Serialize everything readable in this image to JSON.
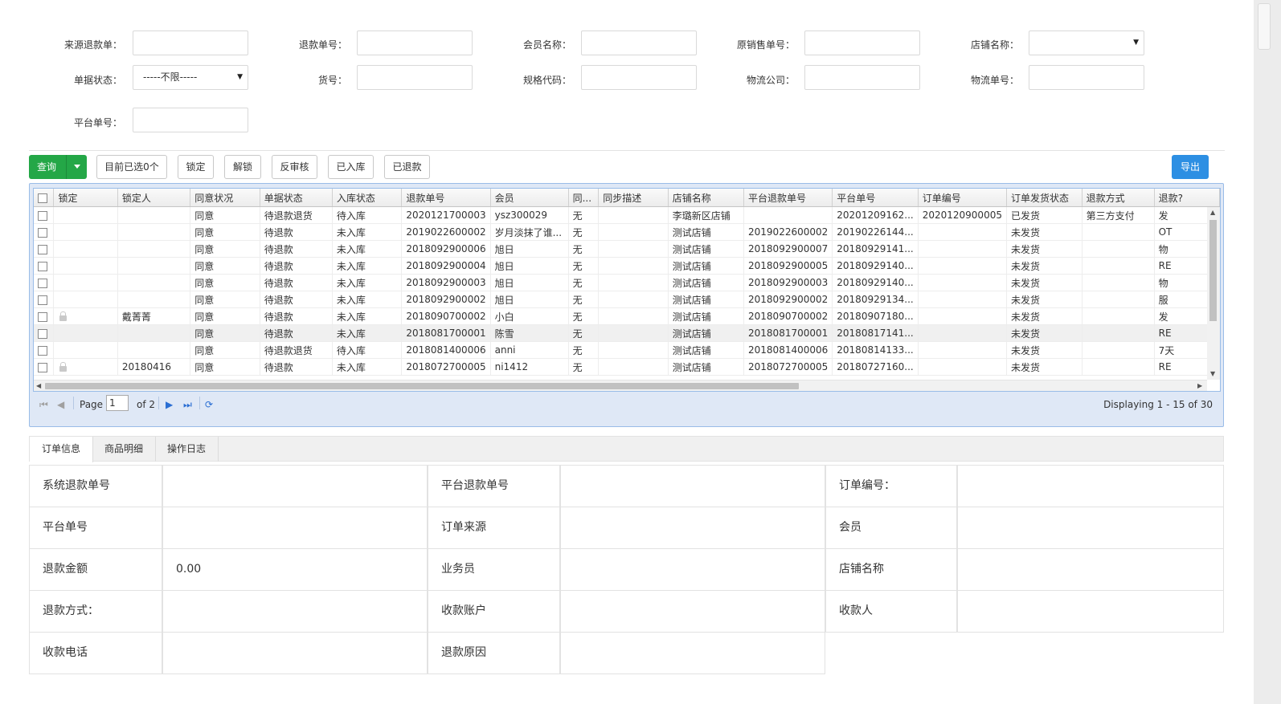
{
  "filters": {
    "labels": [
      "来源退款单：",
      "退款单号：",
      "会员名称：",
      "原销售单号：",
      "店铺名称：",
      "单据状态：",
      "货号：",
      "规格代码：",
      "物流公司：",
      "物流单号：",
      "平台单号："
    ],
    "status_value": "-----不限-----"
  },
  "toolbar": {
    "query": "查询",
    "selected": "目前已选0个",
    "lock": "锁定",
    "unlock": "解锁",
    "unaudit": "反审核",
    "instock": "已入库",
    "refunded": "已退款",
    "export": "导出"
  },
  "grid": {
    "columns": [
      "锁定",
      "锁定人",
      "同意状况",
      "单据状态",
      "入库状态",
      "退款单号",
      "会员",
      "同...",
      "同步描述",
      "店铺名称",
      "平台退款单号",
      "平台单号",
      "订单编号",
      "订单发货状态",
      "退款方式",
      "退款?"
    ],
    "rows": [
      {
        "lock": false,
        "locker": "",
        "agree": "同意",
        "doc": "待退款退货",
        "stock": "待入库",
        "refund_no": "2020121700003",
        "member": "ysz300029",
        "sync": "无",
        "sync_desc": "",
        "shop": "李璐新区店铺",
        "plat_refund": "",
        "plat_no": "20201209162...",
        "order_no": "2020120900005",
        "ship": "已发货",
        "method": "第三方支付",
        "extra": "发"
      },
      {
        "lock": false,
        "locker": "",
        "agree": "同意",
        "doc": "待退款",
        "stock": "未入库",
        "refund_no": "2019022600002",
        "member": "岁月淡抹了谁...",
        "sync": "无",
        "sync_desc": "",
        "shop": "测试店铺",
        "plat_refund": "2019022600002",
        "plat_no": "20190226144...",
        "order_no": "",
        "ship": "未发货",
        "method": "",
        "extra": "OT"
      },
      {
        "lock": false,
        "locker": "",
        "agree": "同意",
        "doc": "待退款",
        "stock": "未入库",
        "refund_no": "2018092900006",
        "member": "旭日",
        "sync": "无",
        "sync_desc": "",
        "shop": "测试店铺",
        "plat_refund": "2018092900007",
        "plat_no": "20180929141...",
        "order_no": "",
        "ship": "未发货",
        "method": "",
        "extra": "物"
      },
      {
        "lock": false,
        "locker": "",
        "agree": "同意",
        "doc": "待退款",
        "stock": "未入库",
        "refund_no": "2018092900004",
        "member": "旭日",
        "sync": "无",
        "sync_desc": "",
        "shop": "测试店铺",
        "plat_refund": "2018092900005",
        "plat_no": "20180929140...",
        "order_no": "",
        "ship": "未发货",
        "method": "",
        "extra": "RE"
      },
      {
        "lock": false,
        "locker": "",
        "agree": "同意",
        "doc": "待退款",
        "stock": "未入库",
        "refund_no": "2018092900003",
        "member": "旭日",
        "sync": "无",
        "sync_desc": "",
        "shop": "测试店铺",
        "plat_refund": "2018092900003",
        "plat_no": "20180929140...",
        "order_no": "",
        "ship": "未发货",
        "method": "",
        "extra": "物"
      },
      {
        "lock": false,
        "locker": "",
        "agree": "同意",
        "doc": "待退款",
        "stock": "未入库",
        "refund_no": "2018092900002",
        "member": "旭日",
        "sync": "无",
        "sync_desc": "",
        "shop": "测试店铺",
        "plat_refund": "2018092900002",
        "plat_no": "20180929134...",
        "order_no": "",
        "ship": "未发货",
        "method": "",
        "extra": "服"
      },
      {
        "lock": true,
        "locker": "戴菁菁",
        "agree": "同意",
        "doc": "待退款",
        "stock": "未入库",
        "refund_no": "2018090700002",
        "member": "小白",
        "sync": "无",
        "sync_desc": "",
        "shop": "测试店铺",
        "plat_refund": "2018090700002",
        "plat_no": "20180907180...",
        "order_no": "",
        "ship": "未发货",
        "method": "",
        "extra": "发"
      },
      {
        "lock": false,
        "locker": "",
        "agree": "同意",
        "doc": "待退款",
        "stock": "未入库",
        "refund_no": "2018081700001",
        "member": "陈雪",
        "sync": "无",
        "sync_desc": "",
        "shop": "测试店铺",
        "plat_refund": "2018081700001",
        "plat_no": "20180817141...",
        "order_no": "",
        "ship": "未发货",
        "method": "",
        "extra": "RE"
      },
      {
        "lock": false,
        "locker": "",
        "agree": "同意",
        "doc": "待退款退货",
        "stock": "待入库",
        "refund_no": "2018081400006",
        "member": "anni",
        "sync": "无",
        "sync_desc": "",
        "shop": "测试店铺",
        "plat_refund": "2018081400006",
        "plat_no": "20180814133...",
        "order_no": "",
        "ship": "未发货",
        "method": "",
        "extra": "7天"
      },
      {
        "lock": true,
        "locker": "20180416",
        "agree": "同意",
        "doc": "待退款",
        "stock": "未入库",
        "refund_no": "2018072700005",
        "member": "ni1412",
        "sync": "无",
        "sync_desc": "",
        "shop": "测试店铺",
        "plat_refund": "2018072700005",
        "plat_no": "20180727160...",
        "order_no": "",
        "ship": "未发货",
        "method": "",
        "extra": "RE"
      }
    ],
    "selected_row": 7
  },
  "pager": {
    "page_label": "Page",
    "page_value": "1",
    "of_label": "of 2",
    "display": "Displaying 1 - 15 of 30"
  },
  "tabs": [
    "订单信息",
    "商品明细",
    "操作日志"
  ],
  "detail": {
    "rows": [
      [
        "系统退款单号",
        "",
        "平台退款单号",
        "",
        "订单编号：",
        ""
      ],
      [
        "平台单号",
        "",
        "订单来源",
        "",
        "会员",
        ""
      ],
      [
        "退款金额",
        "0.00",
        "业务员",
        "",
        "店铺名称",
        ""
      ],
      [
        "退款方式：",
        "",
        "收款账户",
        "",
        "收款人",
        ""
      ],
      [
        "收款电话",
        "",
        "退款原因",
        ""
      ]
    ]
  }
}
